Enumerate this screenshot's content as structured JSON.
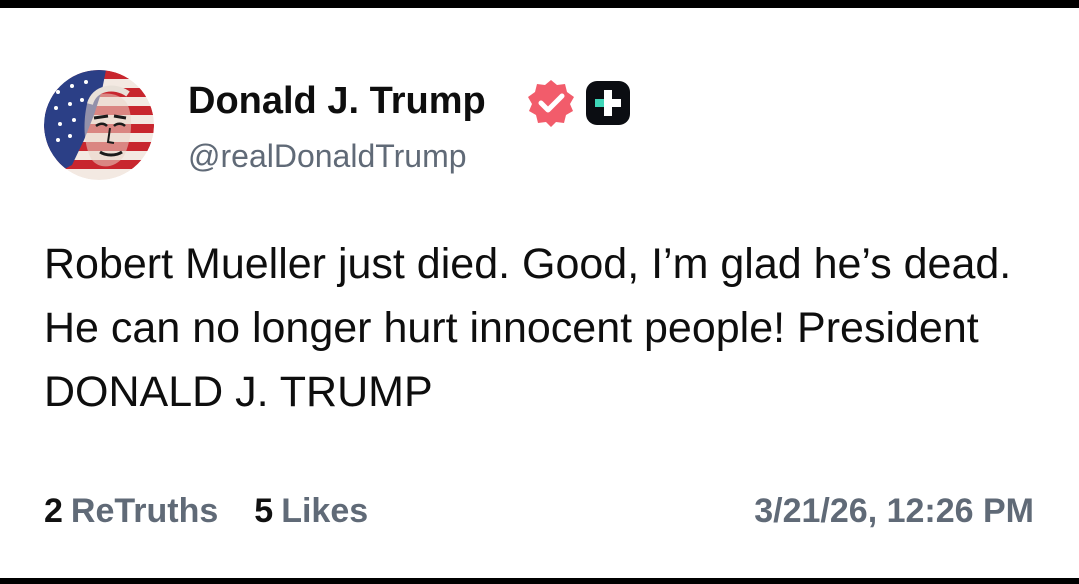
{
  "post": {
    "author_name": "Donald J. Trump",
    "handle": "@realDonaldTrump",
    "text": "Robert Mueller just died. Good, I’m glad he’s dead. He can no longer hurt innocent people! President DONALD J. TRUMP",
    "timestamp": "3/21/26, 12:26 PM"
  },
  "stats": {
    "retruths_count": "2",
    "retruths_label": "ReTruths",
    "likes_count": "5",
    "likes_label": "Likes"
  },
  "icons": {
    "verified": "verified-badge-icon",
    "plus": "plus-badge-icon",
    "avatar": "flag-portrait-avatar"
  },
  "colors": {
    "verified_badge": "#f25c6b",
    "text_primary": "#0e0e0e",
    "text_secondary": "#606a77",
    "plus_badge_bg": "#0b0d12",
    "plus_badge_accent": "#3fd6b8"
  }
}
